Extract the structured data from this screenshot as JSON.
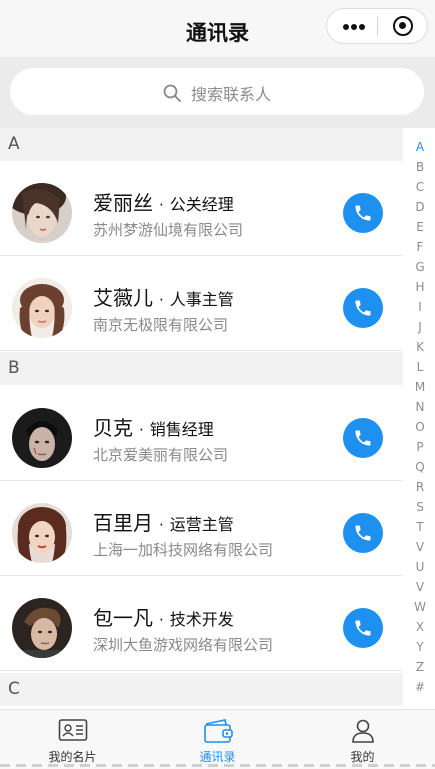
{
  "header": {
    "title": "通讯录"
  },
  "search": {
    "placeholder": "搜索联系人"
  },
  "sections": [
    {
      "letter": "A"
    },
    {
      "letter": "B"
    },
    {
      "letter": "C"
    }
  ],
  "contacts": [
    {
      "name": "爱丽丝",
      "role": "公关经理",
      "company": "苏州梦游仙境有限公司"
    },
    {
      "name": "艾薇儿",
      "role": "人事主管",
      "company": "南京无极限有限公司"
    },
    {
      "name": "贝克",
      "role": "销售经理",
      "company": "北京爱美丽有限公司"
    },
    {
      "name": "百里月",
      "role": "运营主管",
      "company": "上海一加科技网络有限公司"
    },
    {
      "name": "包一凡",
      "role": "技术开发",
      "company": "深圳大鱼游戏网络有限公司"
    }
  ],
  "separator": "·",
  "alphabet": [
    "A",
    "B",
    "C",
    "D",
    "E",
    "F",
    "G",
    "H",
    "I",
    "J",
    "K",
    "L",
    "M",
    "N",
    "O",
    "P",
    "Q",
    "R",
    "S",
    "T",
    "V",
    "U",
    "V",
    "W",
    "X",
    "Y",
    "Z",
    "#"
  ],
  "alphabet_active": "A",
  "tabs": [
    {
      "label": "我的名片",
      "icon": "business-card-icon"
    },
    {
      "label": "通讯录",
      "icon": "contacts-book-icon",
      "active": true
    },
    {
      "label": "我的",
      "icon": "user-profile-icon"
    }
  ],
  "colors": {
    "accent": "#1e90f0",
    "section_bg": "#f2f2f2",
    "subtext": "#8a8a8a"
  }
}
